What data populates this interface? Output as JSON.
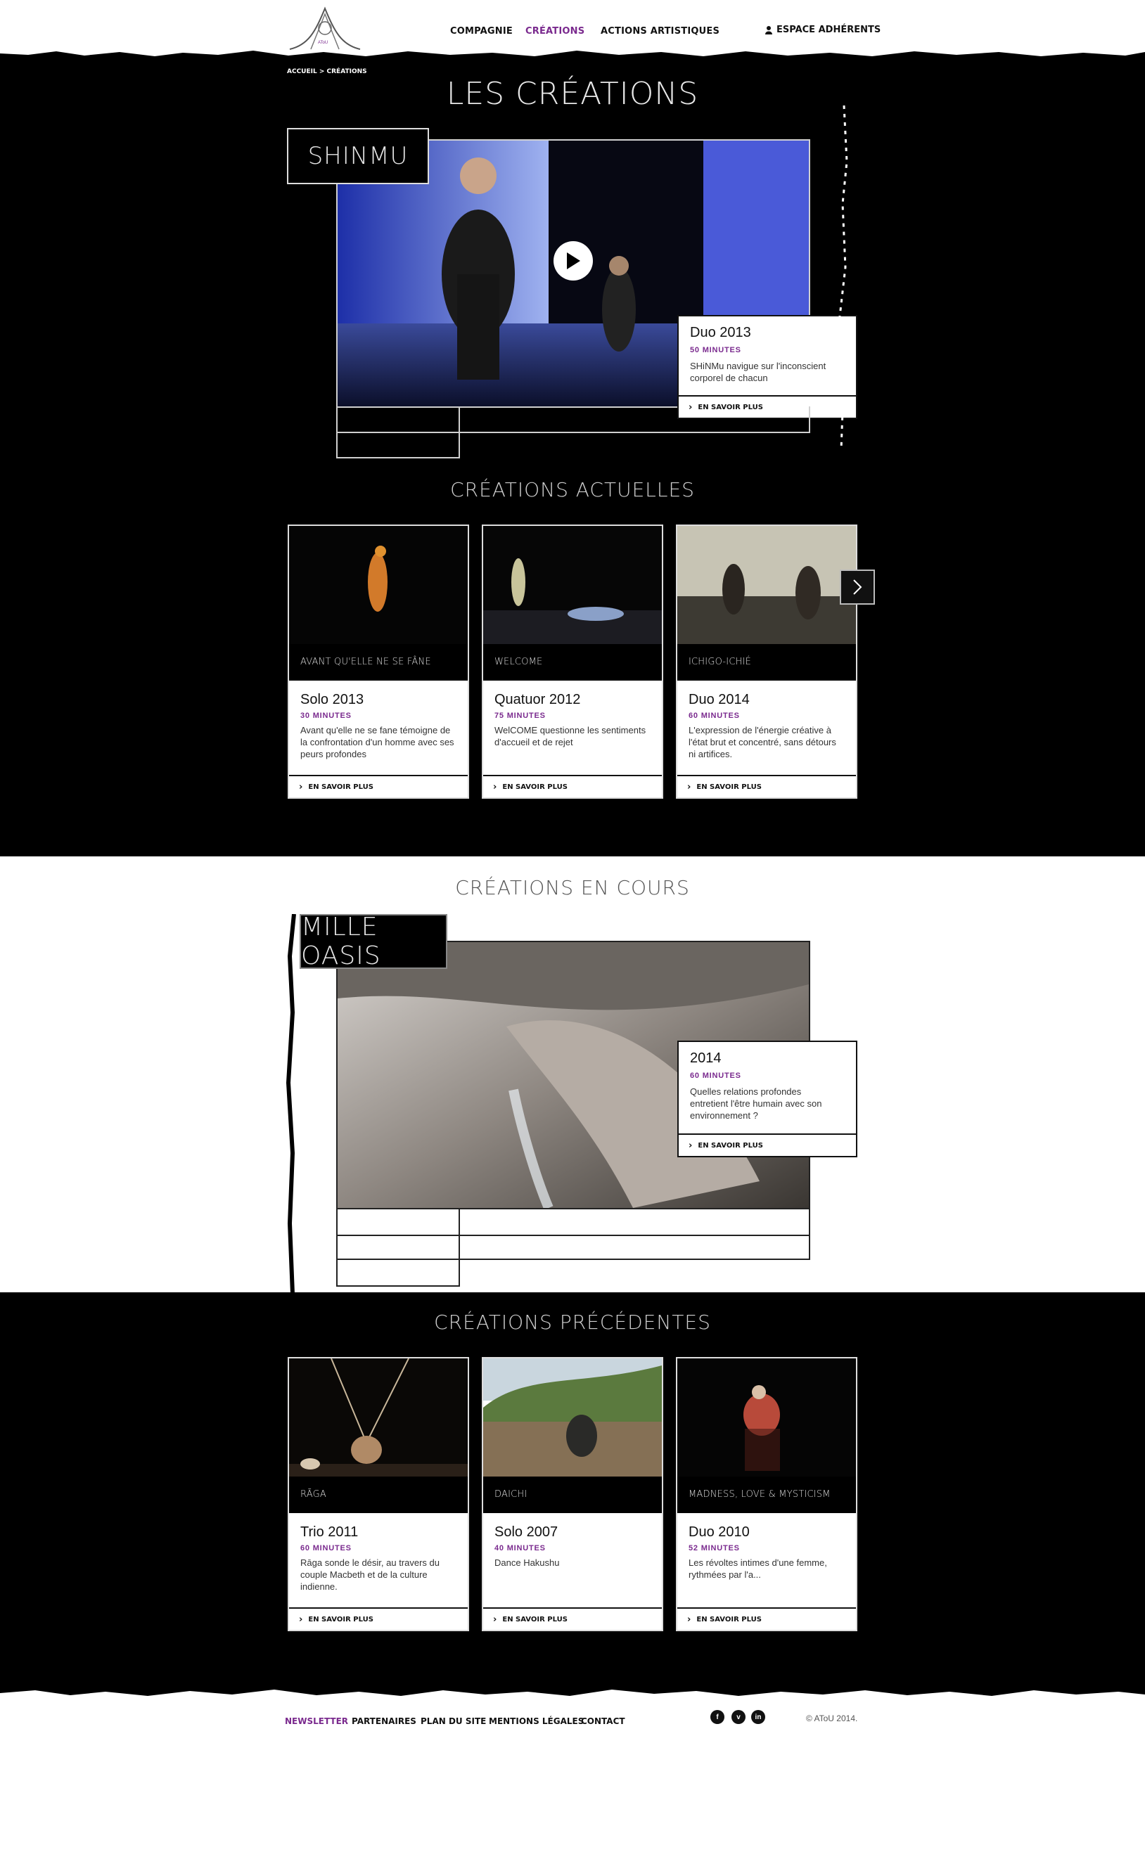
{
  "header": {
    "logo_text": "AToU",
    "nav": [
      {
        "label": "COMPAGNIE"
      },
      {
        "label": "CRÉATIONS"
      },
      {
        "label": "ACTIONS ARTISTIQUES"
      }
    ],
    "member_label": "ESPACE ADHÉRENTS",
    "member_icon": "user-icon"
  },
  "breadcrumb": "ACCUEIL > CRÉATIONS",
  "page_title": "LES CRÉATIONS",
  "featured": {
    "name": "SHINMU",
    "card": {
      "title": "Duo 2013",
      "duration": "50 MINUTES",
      "text": "SHiNMu navigue sur l'inconscient corporel de chacun",
      "more": "EN SAVOIR PLUS"
    },
    "play_icon": "play-icon"
  },
  "current": {
    "heading": "CRÉATIONS ACTUELLES",
    "next_icon": "chevron-right-icon",
    "cards": [
      {
        "caption": "AVANT QU'ELLE NE SE FÂNE",
        "title": "Solo 2013",
        "duration": "30 MINUTES",
        "text": "Avant qu'elle ne se fane témoigne de la confrontation d'un homme avec ses peurs profondes",
        "more": "EN SAVOIR PLUS"
      },
      {
        "caption": "WELCOME",
        "title": "Quatuor 2012",
        "duration": "75 MINUTES",
        "text": "WelCOME questionne les sentiments d'accueil et de rejet",
        "more": "EN SAVOIR PLUS"
      },
      {
        "caption": "ICHIGO-ICHIÉ",
        "title": "Duo 2014",
        "duration": "60 MINUTES",
        "text": "L'expression de l'énergie créative à l'état brut et concentré, sans détours ni artifices.",
        "more": "EN SAVOIR PLUS"
      }
    ]
  },
  "in_progress": {
    "heading": "CRÉATIONS EN COURS",
    "name": "MILLE OASIS",
    "card": {
      "title": "2014",
      "duration": "60 MINUTES",
      "text": "Quelles relations profondes entretient l'être humain avec son environnement ?",
      "more": "EN SAVOIR PLUS"
    }
  },
  "previous": {
    "heading": "CRÉATIONS PRÉCÉDENTES",
    "cards": [
      {
        "caption": "RĀGA",
        "title": "Trio 2011",
        "duration": "60 MINUTES",
        "text": "Rāga sonde le désir, au travers du couple Macbeth et de la culture indienne.",
        "more": "EN SAVOIR PLUS"
      },
      {
        "caption": "DAICHI",
        "title": "Solo 2007",
        "duration": "40 MINUTES",
        "text": "Dance Hakushu",
        "more": "EN SAVOIR PLUS"
      },
      {
        "caption": "MADNESS, LOVE & MYSTICISM",
        "title": "Duo 2010",
        "duration": "52 MINUTES",
        "text": "Les révoltes intimes d'une femme, rythmées par l'a...",
        "more": "EN SAVOIR PLUS"
      }
    ]
  },
  "footer": {
    "links": [
      {
        "label": "NEWSLETTER"
      },
      {
        "label": "PARTENAIRES"
      },
      {
        "label": "PLAN DU SITE"
      },
      {
        "label": "MENTIONS LÉGALES"
      },
      {
        "label": "CONTACT"
      }
    ],
    "social": [
      {
        "label": "f",
        "icon": "facebook-icon"
      },
      {
        "label": "v",
        "icon": "vimeo-icon"
      },
      {
        "label": "in",
        "icon": "linkedin-icon"
      }
    ],
    "copyright": "© AToU 2014."
  },
  "colors": {
    "accent": "#7a2a8e",
    "dark": "#000000",
    "text": "#111111"
  }
}
